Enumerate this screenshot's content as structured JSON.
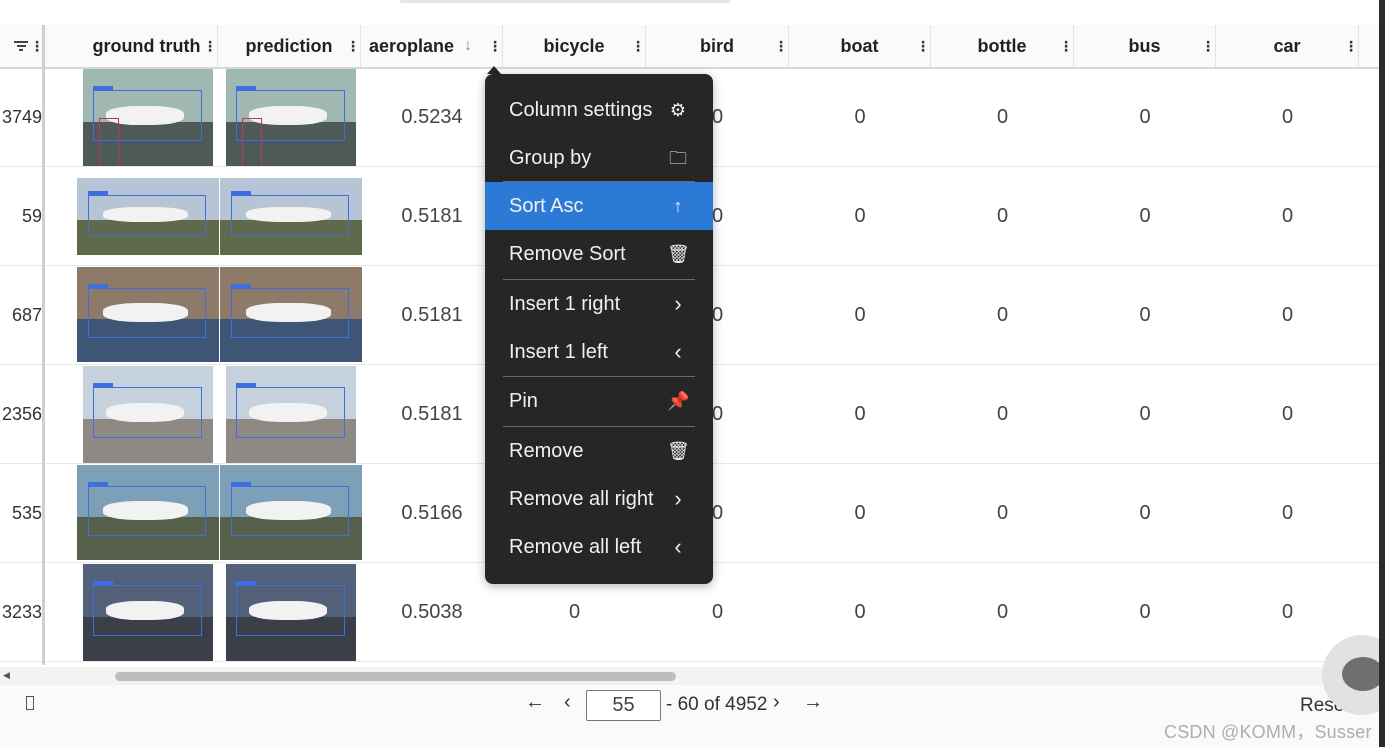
{
  "table": {
    "columns": [
      {
        "label": "ground truth"
      },
      {
        "label": "prediction"
      },
      {
        "label": "aeroplane",
        "sort_indicator": "↓"
      },
      {
        "label": "bicycle"
      },
      {
        "label": "bird"
      },
      {
        "label": "boat"
      },
      {
        "label": "bottle"
      },
      {
        "label": "bus"
      },
      {
        "label": "car"
      }
    ],
    "rows": [
      {
        "id": "3749",
        "aeroplane": "0.5234",
        "bicycle": "",
        "bird": "0",
        "boat": "0",
        "bottle": "0",
        "bus": "0",
        "car": "0"
      },
      {
        "id": "59",
        "aeroplane": "0.5181",
        "bicycle": "",
        "bird": "0",
        "boat": "0",
        "bottle": "0",
        "bus": "0",
        "car": "0"
      },
      {
        "id": "687",
        "aeroplane": "0.5181",
        "bicycle": "",
        "bird": "0",
        "boat": "0",
        "bottle": "0",
        "bus": "0",
        "car": "0"
      },
      {
        "id": "2356",
        "aeroplane": "0.5181",
        "bicycle": "",
        "bird": "0",
        "boat": "0",
        "bottle": "0",
        "bus": "0",
        "car": "0"
      },
      {
        "id": "535",
        "aeroplane": "0.5166",
        "bicycle": "",
        "bird": "0",
        "boat": "0",
        "bottle": "0",
        "bus": "0",
        "car": "0"
      },
      {
        "id": "3233",
        "aeroplane": "0.5038",
        "bicycle": "0",
        "bird": "0",
        "boat": "0",
        "bottle": "0",
        "bus": "0",
        "car": "0"
      }
    ]
  },
  "context_menu": {
    "items": [
      {
        "label": "Column settings",
        "icon": "gear-icon"
      },
      {
        "label": "Group by",
        "icon": "folder-icon"
      },
      {
        "label": "Sort Asc",
        "icon": "arrow-up-icon",
        "active": true
      },
      {
        "label": "Remove Sort",
        "icon": "trash-icon"
      },
      {
        "label": "Insert 1 right",
        "icon": "chevron-right-icon"
      },
      {
        "label": "Insert 1 left",
        "icon": "chevron-left-icon"
      },
      {
        "label": "Pin",
        "icon": "pin-icon"
      },
      {
        "label": "Remove",
        "icon": "trash-icon"
      },
      {
        "label": "Remove all right",
        "icon": "chevron-right-icon"
      },
      {
        "label": "Remove all left",
        "icon": "chevron-left-icon"
      }
    ]
  },
  "pagination": {
    "first": "←",
    "prev": "‹",
    "page_value": "55",
    "range_text": "- 60 of 4952",
    "next": "›",
    "last": "→",
    "reset_label": "Reset"
  },
  "watermark": "CSDN @KOMM，Susser",
  "colors": {
    "accent": "#2d7ad6",
    "menu_bg": "#262626",
    "sort_arrow": "#5b9bd5",
    "bbox_blue": "#3d6fe0",
    "bbox_red": "#c0306b"
  }
}
